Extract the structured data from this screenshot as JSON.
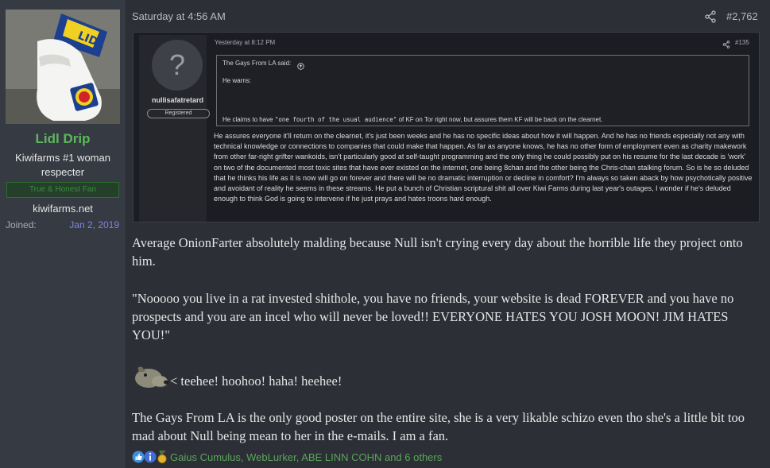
{
  "user": {
    "name": "Lidl Drip",
    "title": "Kiwifarms #1 woman respecter",
    "banner": "True & Honest Fan",
    "site": "kiwifarms.net",
    "joined_label": "Joined:",
    "joined_value": "Jan 2, 2019"
  },
  "post": {
    "time": "Saturday at 4:56 AM",
    "number": "#2,762",
    "paragraphs": [
      "Average OnionFarter absolutely malding because Null isn't crying every day about the horrible life they project onto him.",
      "\"Nooooo you live in a rat invested shithole, you have no friends, your website is dead FOREVER and you have no prospects and you are an incel who will never be loved!! EVERYONE HATES YOU JOSH MOON! JIM HATES YOU!\"",
      "< teehee! hoohoo! haha! heehee!",
      "The Gays From LA is the only good poster on the entire site, she is a very likable schizo even tho she's a little bit too mad about Null being mean to her in the e-mails. I am a fan."
    ]
  },
  "embed": {
    "username": "nullisafatretard",
    "role": "Registered",
    "time": "Yesterday at 8:12 PM",
    "number": "#135",
    "quote_author": "The Gays From LA said:",
    "quote_line1": "He warns:",
    "quote_line2_pre": "He claims to have ",
    "quote_line2_mono": "\"one fourth of the usual audience\"",
    "quote_line2_post": " of KF on Tor right now, but assures them KF will be back on the clearnet.",
    "body": "He assures everyone it'll return on the clearnet, it's just been weeks and he has no specific ideas about how it will happen. And he has no friends especially not any with technical knowledge or connections to companies that could make that happen. As far as anyone knows, he has no other form of employment even as charity makework from other far-right grifter wankoids, isn't particularly good at self-taught programming and the only thing he could possibly put on his resume for the last decade is 'work' on two of the documented most toxic sites that have ever existed on the internet, one being 8chan and the other being the Chris-chan stalking forum. So is he so deluded that he thinks his life as it is now will go on forever and there will be no dramatic interruption or decline in comfort? I'm always so taken aback by how psychotically positive and avoidant of reality he seems in these streams. He put a bunch of Christian scriptural shit all over Kiwi Farms during last year's outages, I wonder if he's deluded enough to think God is going to intervene if he just prays and hates troons hard enough."
  },
  "reactions": {
    "icons": [
      "thumbs-up-icon",
      "info-icon",
      "medal-icon"
    ],
    "text": "Gaius Cumulus, WebLurker, ABE LINN COHN and 6 others"
  },
  "colors": {
    "background": "#2c2f36",
    "username": "#5cb85c",
    "joined": "#7f87e0",
    "reaction_text": "#5aa55a"
  }
}
